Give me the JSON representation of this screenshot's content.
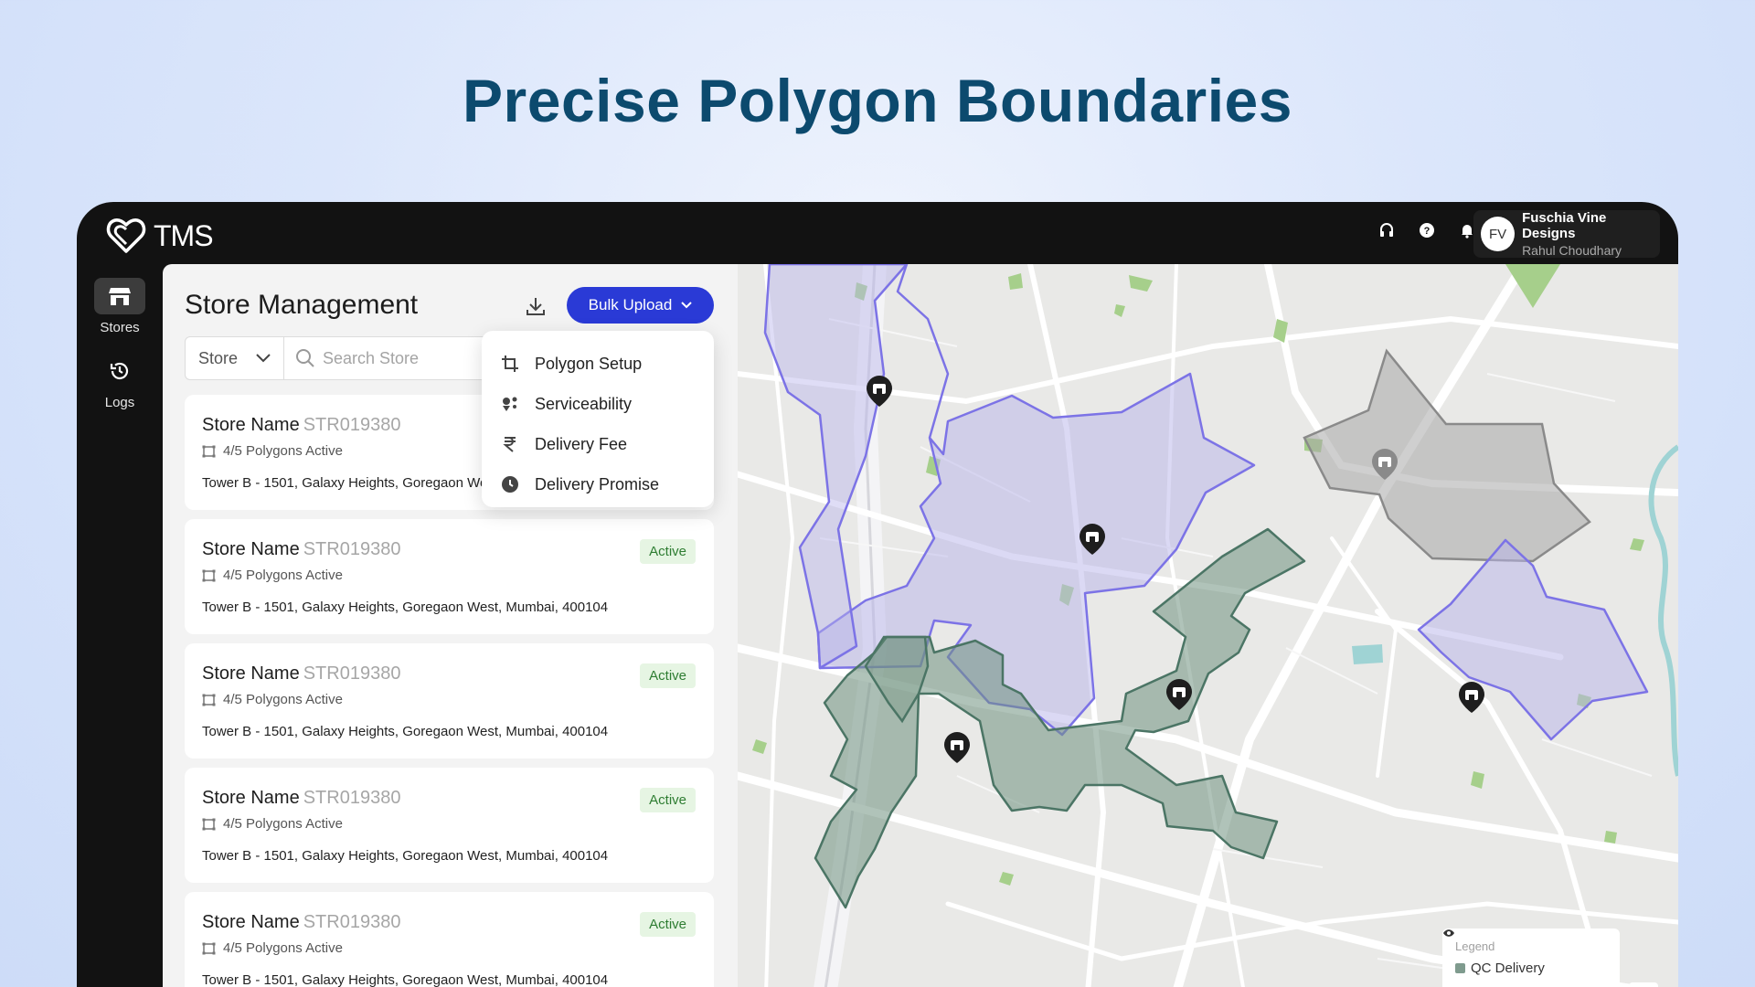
{
  "hero": {
    "title": "Precise Polygon Boundaries"
  },
  "app": {
    "brand": "TMS",
    "profile": {
      "initials": "FV",
      "company": "Fuschia Vine Designs",
      "user": "Rahul Choudhary"
    },
    "top_icons": [
      "headset-icon",
      "help-icon",
      "bell-icon"
    ]
  },
  "sidebar": {
    "items": [
      {
        "label": "Stores",
        "icon": "store-icon",
        "active": true
      },
      {
        "label": "Logs",
        "icon": "history-icon",
        "active": false
      }
    ]
  },
  "panel": {
    "title": "Store Management",
    "bulk_upload_label": "Bulk Upload",
    "filter": {
      "selected": "Store",
      "search_placeholder": "Search Store"
    },
    "dropdown": [
      {
        "label": "Polygon Setup",
        "icon": "crop-icon"
      },
      {
        "label": "Serviceability",
        "icon": "serviceability-icon"
      },
      {
        "label": "Delivery Fee",
        "icon": "rupee-icon"
      },
      {
        "label": "Delivery Promise",
        "icon": "clock-icon"
      }
    ],
    "stores": [
      {
        "name": "Store Name",
        "id": "STR019380",
        "polygons": "4/5 Polygons Active",
        "address": "Tower B - 1501, Galaxy Heights, Goregaon West, Mumbai, 400104",
        "status": ""
      },
      {
        "name": "Store Name",
        "id": "STR019380",
        "polygons": "4/5 Polygons Active",
        "address": "Tower B - 1501, Galaxy Heights, Goregaon West, Mumbai, 400104",
        "status": "Active"
      },
      {
        "name": "Store Name",
        "id": "STR019380",
        "polygons": "4/5 Polygons Active",
        "address": "Tower B - 1501, Galaxy Heights, Goregaon West, Mumbai, 400104",
        "status": "Active"
      },
      {
        "name": "Store Name",
        "id": "STR019380",
        "polygons": "4/5 Polygons Active",
        "address": "Tower B - 1501, Galaxy Heights, Goregaon West, Mumbai, 400104",
        "status": "Active"
      },
      {
        "name": "Store Name",
        "id": "STR019380",
        "polygons": "4/5 Polygons Active",
        "address": "Tower B - 1501, Galaxy Heights, Goregaon West, Mumbai, 400104",
        "status": "Active"
      }
    ]
  },
  "map": {
    "legend": {
      "title": "Legend",
      "items": [
        {
          "label": "QC Delivery",
          "color": "#7f9b8e"
        }
      ]
    },
    "zoom_in_label": "+",
    "colors": {
      "purple_fill": "#b8b4ea",
      "purple_stroke": "#7c73e6",
      "green_fill": "#6f917f",
      "green_stroke": "#4b7565",
      "gray_fill": "#a8a8a8",
      "gray_stroke": "#8a8a8a"
    }
  }
}
